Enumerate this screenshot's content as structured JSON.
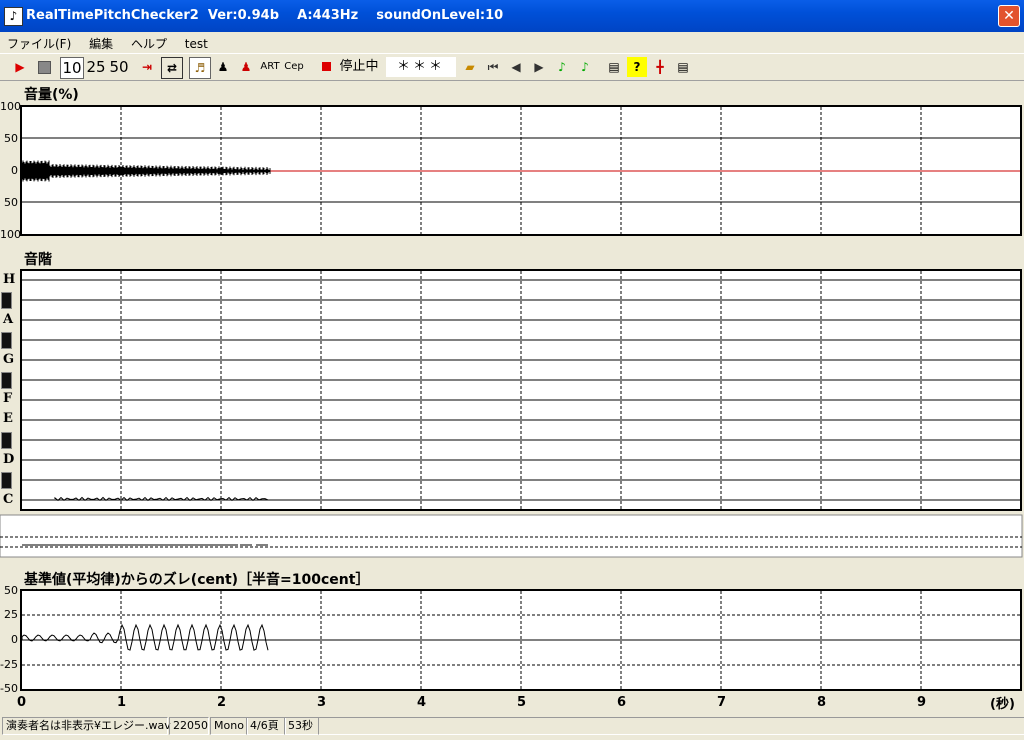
{
  "window": {
    "title": "RealTimePitchChecker2  Ver:0.94b    A:443Hz    soundOnLevel:10",
    "close": "✕"
  },
  "menu": [
    "ファイル(F)",
    "編集",
    "ヘルプ",
    "test"
  ],
  "toolbar": {
    "zoom_buttons": [
      "10",
      "25",
      "50"
    ],
    "art": "ART",
    "cep": "Cep",
    "status": "停止中",
    "note_display": "＊＊＊"
  },
  "volume_panel": {
    "title": "音量(%)",
    "y_labels": [
      "100",
      "50",
      "0",
      "50",
      "100"
    ]
  },
  "scale_panel": {
    "title": "音階",
    "notes": [
      "H",
      "A",
      "G",
      "F",
      "E",
      "D",
      "C"
    ]
  },
  "cent_panel": {
    "title": "基準値(平均律)からのズレ(cent)［半音=100cent］",
    "y_labels": [
      "50",
      "25",
      "0",
      "-25",
      "-50"
    ]
  },
  "time_axis": {
    "labels": [
      "0",
      "1",
      "2",
      "3",
      "4",
      "5",
      "6",
      "7",
      "8",
      "9"
    ],
    "unit": "(秒)"
  },
  "statusbar": [
    "演奏者名は非表示¥エレジー.wav",
    "22050",
    "Mono",
    "4/6頁",
    "53秒"
  ],
  "colors": {
    "title_bg": "#0054e3",
    "baseline_red": "#cc0000",
    "play_red": "#dd0000"
  }
}
